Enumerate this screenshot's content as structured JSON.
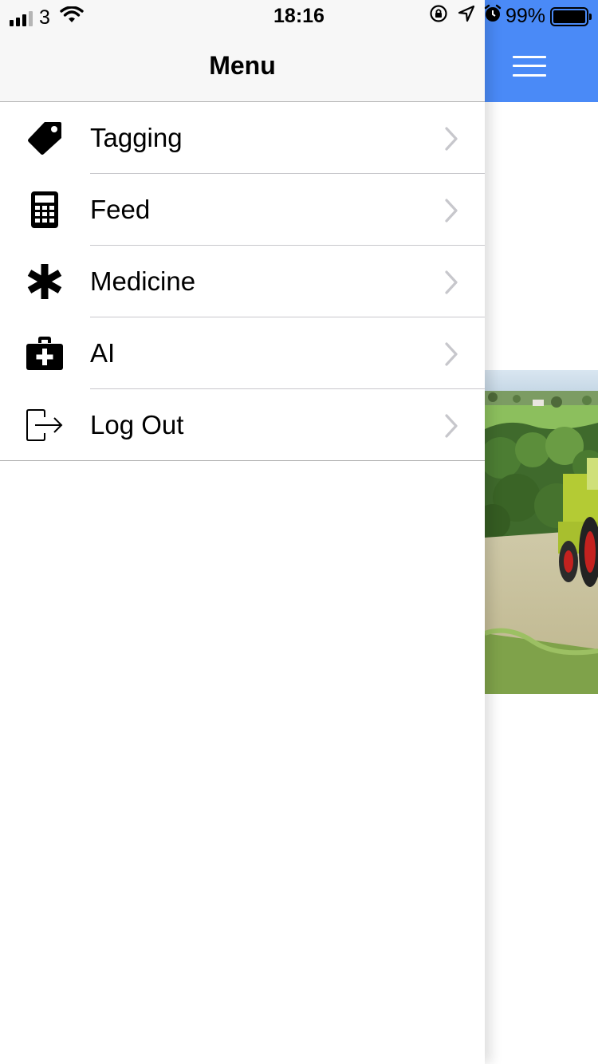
{
  "status_bar": {
    "carrier": "3",
    "time": "18:16",
    "battery_percent": "99%",
    "battery_level": 0.99,
    "signal_bars_active": 3,
    "signal_bars_total": 4
  },
  "menu": {
    "title": "Menu",
    "items": [
      {
        "label": "Tagging",
        "icon": "tag-icon"
      },
      {
        "label": "Feed",
        "icon": "calculator-icon"
      },
      {
        "label": "Medicine",
        "icon": "asterisk-icon"
      },
      {
        "label": "AI",
        "icon": "medkit-icon"
      },
      {
        "label": "Log Out",
        "icon": "sign-out-icon"
      }
    ]
  },
  "app_header": {
    "color": "#4a8af7",
    "menu_icon": "hamburger-icon"
  },
  "colors": {
    "accent": "#4a8af7",
    "menu_header_bg": "#f7f7f7",
    "chevron": "#c7c7cc"
  }
}
